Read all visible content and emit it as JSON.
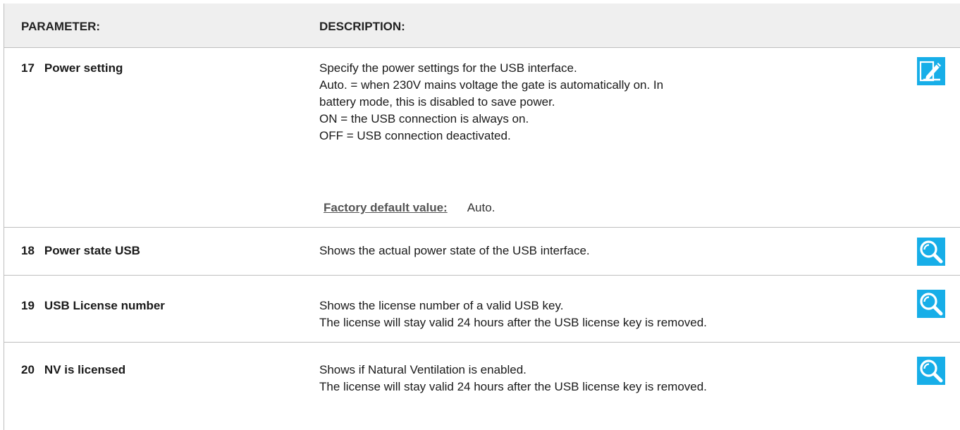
{
  "header": {
    "parameter": "PARAMETER:",
    "description": "DESCRIPTION:"
  },
  "rows": [
    {
      "number": "17",
      "name": "Power setting",
      "description": [
        "Specify the power settings for the USB interface.",
        "Auto. = when 230V mains voltage the gate is automatically on. In",
        "battery mode, this is disabled to save power.",
        "ON = the USB connection is always on.",
        "OFF = USB connection deactivated."
      ],
      "default_label": "Factory default value:",
      "default_value": "Auto.",
      "icon": "edit-icon"
    },
    {
      "number": "18",
      "name": "Power state USB",
      "description": [
        "Shows the actual power state of the USB interface."
      ],
      "icon": "magnifier-icon"
    },
    {
      "number": "19",
      "name": "USB License number",
      "description": [
        "Shows the license number of a valid USB key.",
        "The license will stay valid 24 hours after the USB license key is removed."
      ],
      "icon": "magnifier-icon"
    },
    {
      "number": "20",
      "name": "NV is licensed",
      "description": [
        "Shows if Natural Ventilation is enabled.",
        "The license will stay valid 24 hours after the USB license key is removed."
      ],
      "icon": "magnifier-icon"
    }
  ],
  "colors": {
    "icon_bg": "#17aee8",
    "header_bg": "#efefef",
    "border": "#bfbfbf"
  }
}
